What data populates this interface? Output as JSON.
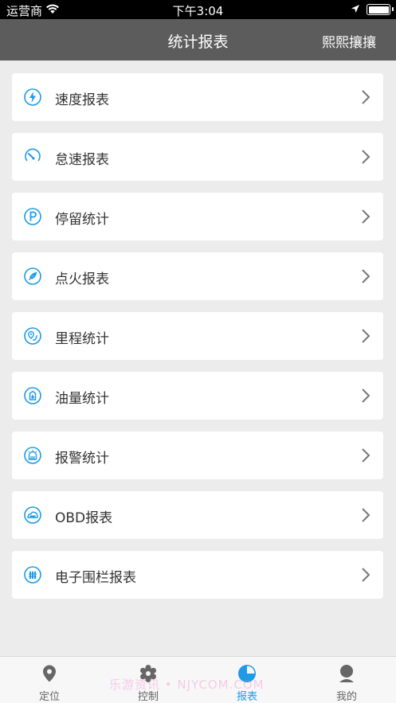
{
  "status": {
    "carrier": "运营商",
    "time": "下午3:04"
  },
  "nav": {
    "title": "统计报表",
    "right": "熙熙攘攘"
  },
  "items": [
    {
      "label": "速度报表",
      "icon": "lightning-icon"
    },
    {
      "label": "怠速报表",
      "icon": "gauge-icon"
    },
    {
      "label": "停留统计",
      "icon": "parking-icon"
    },
    {
      "label": "点火报表",
      "icon": "flame-icon"
    },
    {
      "label": "里程统计",
      "icon": "route-icon"
    },
    {
      "label": "油量统计",
      "icon": "fuel-icon"
    },
    {
      "label": "报警统计",
      "icon": "alarm-icon"
    },
    {
      "label": "OBD报表",
      "icon": "obd-icon"
    },
    {
      "label": "电子围栏报表",
      "icon": "fence-icon"
    }
  ],
  "tabs": [
    {
      "label": "定位",
      "icon": "location-pin-icon"
    },
    {
      "label": "控制",
      "icon": "gear-icon"
    },
    {
      "label": "报表",
      "icon": "pie-chart-icon"
    },
    {
      "label": "我的",
      "icon": "user-icon"
    }
  ],
  "watermark": "乐游资讯 • NJYCOM.COM",
  "colors": {
    "accent": "#1e9be8",
    "navbar": "#5c5c5c",
    "background": "#ececec"
  }
}
